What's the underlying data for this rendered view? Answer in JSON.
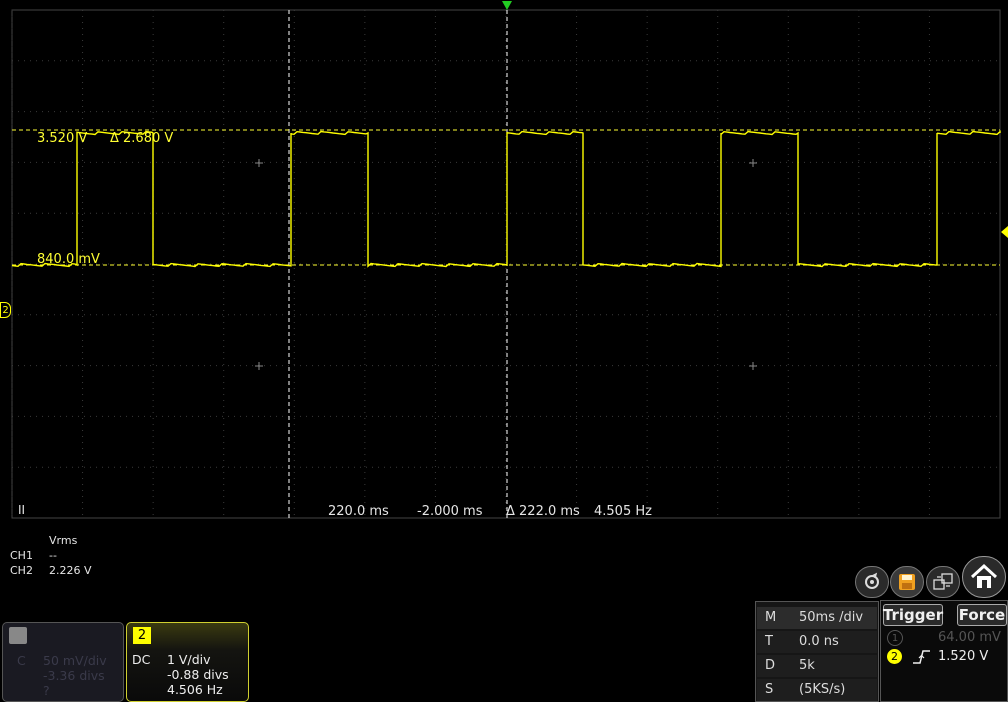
{
  "cursors": {
    "v_upper": "3.520 V",
    "v_delta": "Δ 2.680 V",
    "v_lower": "840.0 mV",
    "t_a": "220.0 ms",
    "t_b": "-2.000 ms",
    "t_delta": "Δ 222.0 ms",
    "t_freq": "4.505 Hz"
  },
  "run_state": "II",
  "left_marker": "2",
  "measurements": {
    "header": "Vrms",
    "rows": [
      {
        "ch": "CH1",
        "value": "--"
      },
      {
        "ch": "CH2",
        "value": "2.226 V"
      }
    ]
  },
  "ch1": {
    "coupling": "C",
    "scale": "50 mV/div",
    "offset": "-3.36 divs",
    "extra": "?"
  },
  "ch2": {
    "number": "2",
    "coupling": "DC",
    "scale": "1 V/div",
    "offset": "-0.88 divs",
    "freq": "4.506 Hz"
  },
  "timebase": {
    "rows": [
      {
        "key": "M",
        "value": "50ms /div"
      },
      {
        "key": "T",
        "value": "0.0 ns"
      },
      {
        "key": "D",
        "value": "5k"
      },
      {
        "key": "S",
        "value": "(5KS/s)"
      }
    ]
  },
  "trigger": {
    "trigger_label": "Trigger",
    "force_label": "Force",
    "ch1_num": "1",
    "ch1_level": "64.00 mV",
    "ch2_num": "2",
    "ch2_level": "1.520 V"
  },
  "colors": {
    "trace": "#ffff00",
    "grid": "#555555",
    "trigger_marker": "#22cc22"
  },
  "icons": [
    "auto-scale-icon",
    "save-icon",
    "window-icon",
    "home-icon"
  ]
}
